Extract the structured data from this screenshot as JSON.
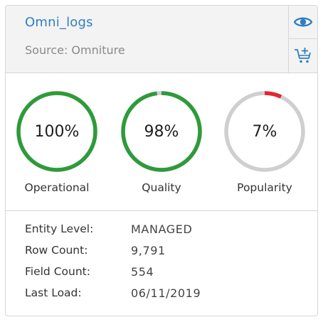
{
  "header": {
    "title": "Omni_logs",
    "source": "Source: Omniture"
  },
  "actions": {
    "view_icon": "eye-icon",
    "cart_icon": "add-to-cart-icon"
  },
  "colors": {
    "accent": "#2f7fc1",
    "good": "#2e9b3a",
    "low": "#e0282e",
    "track": "#cfcfcf"
  },
  "metrics": [
    {
      "value": "100%",
      "label": "Operational",
      "percent": 100,
      "color": "#2e9b3a"
    },
    {
      "value": "98%",
      "label": "Quality",
      "percent": 98,
      "color": "#2e9b3a"
    },
    {
      "value": "7%",
      "label": "Popularity",
      "percent": 7,
      "color": "#e0282e"
    }
  ],
  "details": [
    {
      "key": "Entity Level:",
      "value": "MANAGED"
    },
    {
      "key": "Row Count:",
      "value": "9,791"
    },
    {
      "key": "Field Count:",
      "value": "554"
    },
    {
      "key": "Last Load:",
      "value": "06/11/2019"
    }
  ]
}
